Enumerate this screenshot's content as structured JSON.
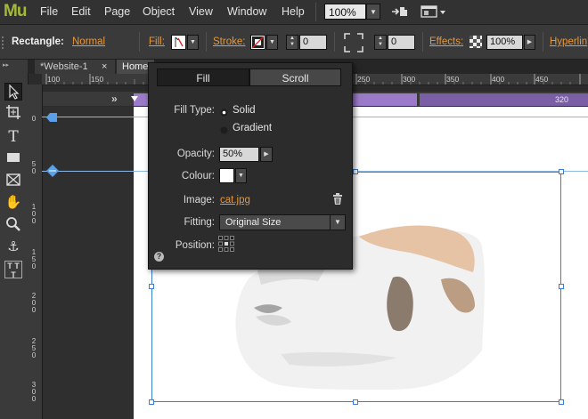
{
  "app": {
    "logo": "Mu",
    "menu": [
      "File",
      "Edit",
      "Page",
      "Object",
      "View",
      "Window",
      "Help"
    ],
    "zoom": "100%"
  },
  "controlbar": {
    "object_label": "Rectangle:",
    "object_value": "Normal",
    "fill_label": "Fill:",
    "stroke_label": "Stroke:",
    "stroke_width": "0",
    "corner_radius": "0",
    "effects_label": "Effects:",
    "opacity": "100%",
    "hyperlink_label": "Hyperlin"
  },
  "tabs": {
    "website_tab": "*Website-1",
    "close_glyph": "×",
    "home_tab": "Home"
  },
  "ruler": {
    "h_ticks": [
      "100",
      "150",
      "250",
      "300",
      "350",
      "400",
      "450"
    ],
    "v_ticks": [
      "0",
      "5\n0",
      "1\n0\n0",
      "1\n5\n0",
      "2\n0\n0",
      "2\n5\n0",
      "3\n0\n0"
    ],
    "breakpoint_value": "320"
  },
  "fill_panel": {
    "tab_fill": "Fill",
    "tab_scroll": "Scroll",
    "fill_type_label": "Fill Type:",
    "solid": "Solid",
    "gradient": "Gradient",
    "opacity_label": "Opacity:",
    "opacity_value": "50%",
    "colour_label": "Colour:",
    "image_label": "Image:",
    "image_file": "cat.jpg",
    "fitting_label": "Fitting:",
    "fitting_value": "Original Size",
    "position_label": "Position:",
    "help_glyph": "?"
  },
  "colors": {
    "accent_orange": "#e8973a",
    "breakpoint_purple": "#9b7bc9",
    "selection_blue": "#3a7fd0"
  }
}
